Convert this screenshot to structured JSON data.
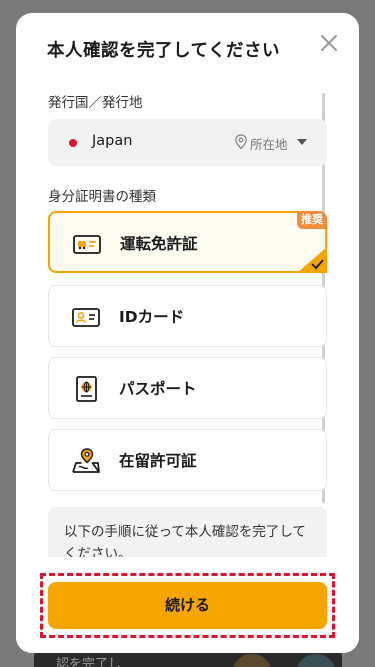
{
  "modal": {
    "title": "本人確認を完了してください",
    "close_icon": "close-icon"
  },
  "country": {
    "section_label": "発行国／発行地",
    "value": "Japan",
    "flag_color": "#d9162d",
    "location_label": "所在地"
  },
  "documents": {
    "section_label": "身分証明書の種類",
    "items": [
      {
        "label": "運転免許証",
        "icon": "driver-license-icon",
        "selected": true,
        "badge": "推奨"
      },
      {
        "label": "IDカード",
        "icon": "id-card-icon",
        "selected": false
      },
      {
        "label": "パスポート",
        "icon": "passport-icon",
        "selected": false
      },
      {
        "label": "在留許可証",
        "icon": "residence-permit-icon",
        "selected": false
      }
    ]
  },
  "note": {
    "text": "以下の手順に従って本人確認を完了してください。"
  },
  "footer": {
    "continue_label": "続ける"
  },
  "background": {
    "partial_text": "認を完了し"
  },
  "colors": {
    "accent": "#f5a400",
    "badge": "#f28a3b",
    "highlight": "#d9162d"
  }
}
